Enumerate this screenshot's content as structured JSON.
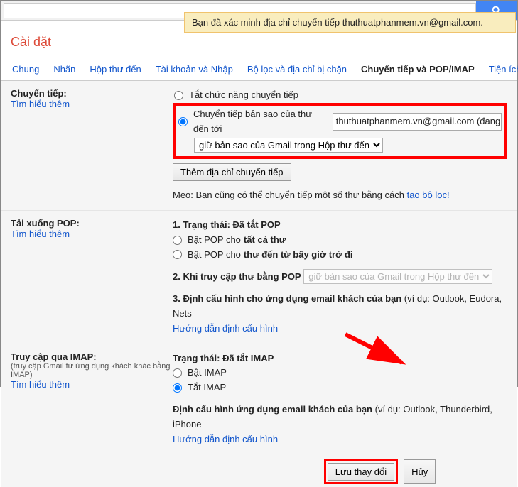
{
  "notice": "Bạn đã xác minh địa chỉ chuyển tiếp thuthuatphanmem.vn@gmail.com.",
  "page_title": "Cài đặt",
  "tabs": {
    "general": "Chung",
    "labels": "Nhãn",
    "inbox": "Hộp thư đến",
    "accounts": "Tài khoản và Nhập",
    "filters": "Bộ lọc và địa chỉ bị chặn",
    "forwarding": "Chuyển tiếp và POP/IMAP",
    "addons": "Tiện ích"
  },
  "forwarding": {
    "heading": "Chuyển tiếp:",
    "learn": "Tìm hiểu thêm",
    "disable": "Tắt chức năng chuyển tiếp",
    "enable_prefix": "Chuyển tiếp bản sao của thư đến tới",
    "email": "thuthuatphanmem.vn@gmail.com (đang đư",
    "keep_copy": "giữ bản sao của Gmail trong Hộp thư đến",
    "add_btn": "Thêm địa chỉ chuyển tiếp",
    "tip_prefix": "Mẹo: Bạn cũng có thể chuyển tiếp một số thư bằng cách ",
    "tip_link": "tạo bộ lọc!"
  },
  "pop": {
    "heading": "Tải xuống POP:",
    "learn": "Tìm hiểu thêm",
    "status_label": "1. Trạng thái: ",
    "status_value": "Đã tắt POP",
    "opt1_prefix": "Bật POP cho ",
    "opt1_bold": "tất cả thư",
    "opt2_prefix": "Bật POP cho ",
    "opt2_bold": "thư đến từ bây giờ trở đi",
    "access_label": "2. Khi truy cập thư bằng POP",
    "access_select": "giữ bản sao của Gmail trong Hộp thư đến",
    "config_label": "3. Định cấu hình cho ứng dụng email khách của bạn ",
    "config_hint": "(ví dụ: Outlook, Eudora, Nets",
    "config_link": "Hướng dẫn định cấu hình"
  },
  "imap": {
    "heading": "Truy cập qua IMAP:",
    "sub": "(truy cập Gmail từ ứng dụng khách khác bằng IMAP)",
    "learn": "Tìm hiểu thêm",
    "status_label": "Trạng thái: ",
    "status_value": "Đã tắt IMAP",
    "opt_on": "Bật IMAP",
    "opt_off": "Tắt IMAP",
    "config_label": "Định cấu hình ứng dụng email khách của bạn ",
    "config_hint": "(ví dụ: Outlook, Thunderbird, iPhone",
    "config_link": "Hướng dẫn định cấu hình"
  },
  "footer": {
    "save": "Lưu thay đổi",
    "cancel": "Hủy"
  }
}
